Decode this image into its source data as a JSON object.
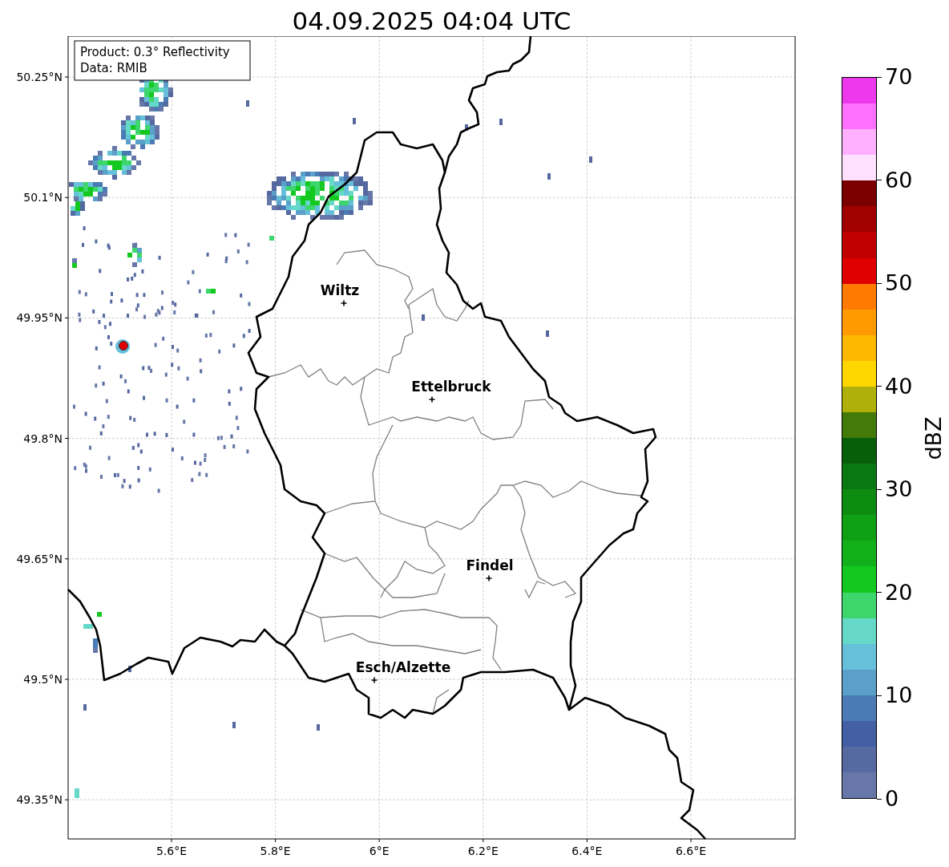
{
  "title": "04.09.2025 04:04 UTC",
  "map": {
    "info_box": [
      "Product: 0.3° Reflectivity",
      "Data: RMIB"
    ],
    "lat_ticks": [
      "50.25°N",
      "50.1°N",
      "49.95°N",
      "49.8°N",
      "49.65°N",
      "49.5°N",
      "49.35°N"
    ],
    "lon_ticks": [
      "5.6°E",
      "5.8°E",
      "6°E",
      "6.2°E",
      "6.4°E",
      "6.6°E"
    ],
    "cities": [
      {
        "name": "Wiltz"
      },
      {
        "name": "Ettelbruck"
      },
      {
        "name": "Findel"
      },
      {
        "name": "Esch/Alzette"
      }
    ]
  },
  "colorbar": {
    "label": "dBZ",
    "ticks": [
      "70",
      "60",
      "50",
      "40",
      "30",
      "20",
      "10",
      "0"
    ],
    "segments": [
      {
        "color": "#ee38ee"
      },
      {
        "color": "#ff70ff"
      },
      {
        "color": "#ffb0ff"
      },
      {
        "color": "#ffe0ff"
      },
      {
        "color": "#7a0000"
      },
      {
        "color": "#a00000"
      },
      {
        "color": "#c00000"
      },
      {
        "color": "#e00000"
      },
      {
        "color": "#ff7a00"
      },
      {
        "color": "#ff9a00"
      },
      {
        "color": "#ffb800"
      },
      {
        "color": "#ffd700"
      },
      {
        "color": "#b0b00a"
      },
      {
        "color": "#447a0a"
      },
      {
        "color": "#085f0a"
      },
      {
        "color": "#0a7810"
      },
      {
        "color": "#0e8c12"
      },
      {
        "color": "#10a014"
      },
      {
        "color": "#12b01a"
      },
      {
        "color": "#13c81e"
      },
      {
        "color": "#3dd66c"
      },
      {
        "color": "#66d8c8"
      },
      {
        "color": "#66c0da"
      },
      {
        "color": "#5aa0c8"
      },
      {
        "color": "#4a7bb4"
      },
      {
        "color": "#4460a4"
      },
      {
        "color": "#5669a0"
      },
      {
        "color": "#6677a8"
      }
    ]
  }
}
